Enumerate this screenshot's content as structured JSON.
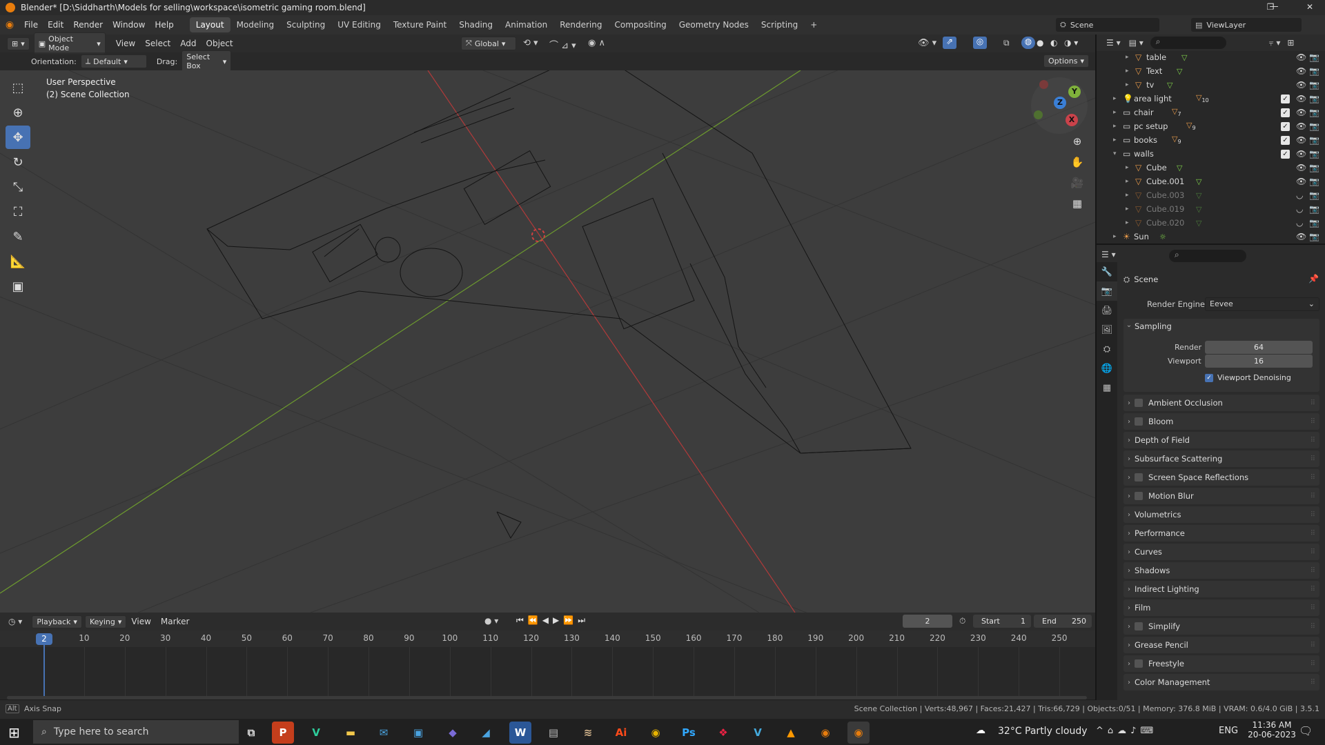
{
  "window": {
    "title": "Blender* [D:\\Siddharth\\Models for selling\\workspace\\isometric gaming room.blend]",
    "controls": [
      "—",
      "❐",
      "✕"
    ]
  },
  "menubar": {
    "menus": [
      "File",
      "Edit",
      "Render",
      "Window",
      "Help"
    ],
    "workspaces": [
      "Layout",
      "Modeling",
      "Sculpting",
      "UV Editing",
      "Texture Paint",
      "Shading",
      "Animation",
      "Rendering",
      "Compositing",
      "Geometry Nodes",
      "Scripting"
    ],
    "active_workspace": "Layout",
    "add_workspace": "+",
    "scene": "Scene",
    "view_layer": "ViewLayer"
  },
  "viewport_header": {
    "mode": "Object Mode",
    "menus": [
      "View",
      "Select",
      "Add",
      "Object"
    ],
    "transform": "Global"
  },
  "tool_header": {
    "orientation_label": "Orientation:",
    "orientation_value": "Default",
    "drag_label": "Drag:",
    "drag_value": "Select Box",
    "options": "Options"
  },
  "viewport": {
    "perspective": "User Perspective",
    "collection": "(2) Scene Collection",
    "gizmo_axes": {
      "x": "X",
      "y": "Y",
      "z": "Z"
    },
    "colors": {
      "x_axis": "#c9424a",
      "y_axis": "#7fb13b",
      "z_axis": "#3a7fd6",
      "grid_bg": "#3d3d3d"
    }
  },
  "outliner": {
    "rows": [
      {
        "label": "table",
        "icon": "mesh-icon"
      },
      {
        "label": "Text",
        "icon": "mesh-icon"
      },
      {
        "label": "tv",
        "icon": "mesh-icon"
      },
      {
        "label": "area light",
        "icon": "light-icon",
        "badge": "10"
      },
      {
        "label": "chair",
        "icon": "collection-icon",
        "badge": "7"
      },
      {
        "label": "pc setup",
        "icon": "collection-icon",
        "badge": "9"
      },
      {
        "label": "books",
        "icon": "collection-icon",
        "badge": "9"
      },
      {
        "label": "walls",
        "icon": "collection-icon"
      },
      {
        "label": "Cube",
        "icon": "mesh-icon"
      },
      {
        "label": "Cube.001",
        "icon": "mesh-icon"
      },
      {
        "label": "Cube.003",
        "icon": "mesh-icon"
      },
      {
        "label": "Cube.019",
        "icon": "mesh-icon"
      },
      {
        "label": "Cube.020",
        "icon": "mesh-icon"
      },
      {
        "label": "Sun",
        "icon": "sun-icon"
      }
    ]
  },
  "properties": {
    "context": "Scene",
    "render_engine_label": "Render Engine",
    "render_engine": "Eevee",
    "sampling": {
      "title": "Sampling",
      "render_label": "Render",
      "render_value": "64",
      "viewport_label": "Viewport",
      "viewport_value": "16",
      "denoise_label": "Viewport Denoising"
    },
    "panels": [
      {
        "label": "Ambient Occlusion",
        "checkbox": true
      },
      {
        "label": "Bloom",
        "checkbox": true
      },
      {
        "label": "Depth of Field",
        "checkbox": false
      },
      {
        "label": "Subsurface Scattering",
        "checkbox": false
      },
      {
        "label": "Screen Space Reflections",
        "checkbox": true
      },
      {
        "label": "Motion Blur",
        "checkbox": true
      },
      {
        "label": "Volumetrics",
        "checkbox": false
      },
      {
        "label": "Performance",
        "checkbox": false
      },
      {
        "label": "Curves",
        "checkbox": false
      },
      {
        "label": "Shadows",
        "checkbox": false
      },
      {
        "label": "Indirect Lighting",
        "checkbox": false
      },
      {
        "label": "Film",
        "checkbox": false
      },
      {
        "label": "Simplify",
        "checkbox": true
      },
      {
        "label": "Grease Pencil",
        "checkbox": false
      },
      {
        "label": "Freestyle",
        "checkbox": true
      },
      {
        "label": "Color Management",
        "checkbox": false
      }
    ]
  },
  "timeline": {
    "menus": [
      "Playback",
      "Keying",
      "View",
      "Marker"
    ],
    "current_frame": "2",
    "start_label": "Start",
    "start": "1",
    "end_label": "End",
    "end": "250",
    "ticks": [
      "10",
      "20",
      "30",
      "40",
      "50",
      "60",
      "70",
      "80",
      "90",
      "100",
      "110",
      "120",
      "130",
      "140",
      "150",
      "160",
      "170",
      "180",
      "190",
      "200",
      "210",
      "220",
      "230",
      "240",
      "250"
    ]
  },
  "statusbar": {
    "key": "Alt",
    "hint": "Axis Snap",
    "stats": "Scene Collection | Verts:48,967 | Faces:21,427 | Tris:66,729 | Objects:0/51 | Memory: 376.8 MiB | VRAM: 0.6/4.0 GiB | 3.5.1"
  },
  "taskbar": {
    "search_placeholder": "Type here to search",
    "weather": "32°C  Partly cloudy",
    "lang": "ENG",
    "time": "11:36 AM",
    "date": "20-06-2023"
  }
}
